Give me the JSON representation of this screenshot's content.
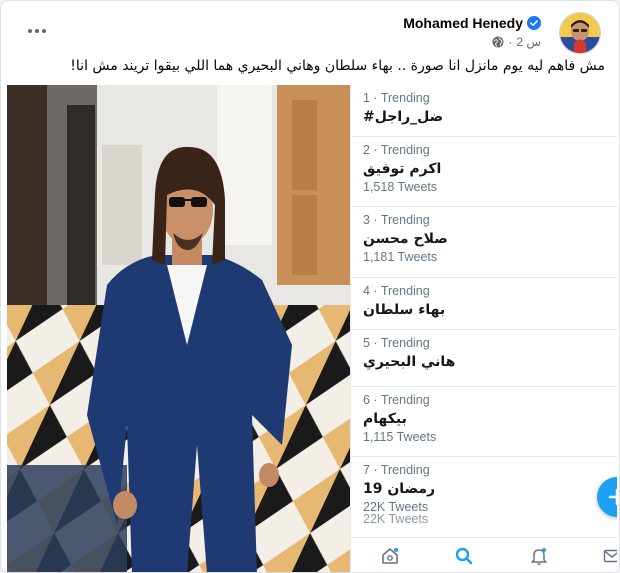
{
  "post": {
    "author": "Mohamed Henedy",
    "time": "2 س",
    "separator": "·",
    "text": "مش فاهم ليه يوم مانزل انا صورة .. بهاء سلطان وهاني البحيري هما اللي بيقوا تريند مش انا!"
  },
  "icons": {
    "verified": "verified-badge-icon",
    "audience": "globe-icon",
    "more": "more-options-icon",
    "compose": "compose-tweet-icon",
    "home": "home-icon",
    "search": "search-icon",
    "notifications": "notifications-icon",
    "messages": "messages-icon"
  },
  "colors": {
    "twitter_blue": "#1da1f2",
    "facebook_verified": "#1877f2"
  },
  "trends": [
    {
      "rank": "1 · Trending",
      "name": "#ضل_راجل",
      "count": ""
    },
    {
      "rank": "2 · Trending",
      "name": "اكرم توفيق",
      "count": "1,518 Tweets"
    },
    {
      "rank": "3 · Trending",
      "name": "صلاح محسن",
      "count": "1,181 Tweets"
    },
    {
      "rank": "4 · Trending",
      "name": "بهاء سلطان",
      "count": ""
    },
    {
      "rank": "5 · Trending",
      "name": "هاني البحيري",
      "count": ""
    },
    {
      "rank": "6 · Trending",
      "name": "بيكهام",
      "count": "1,115 Tweets"
    },
    {
      "rank": "7 · Trending",
      "name": "19 رمضان",
      "count": "22K Tweets",
      "count_ghost": "22K Tweets"
    }
  ]
}
